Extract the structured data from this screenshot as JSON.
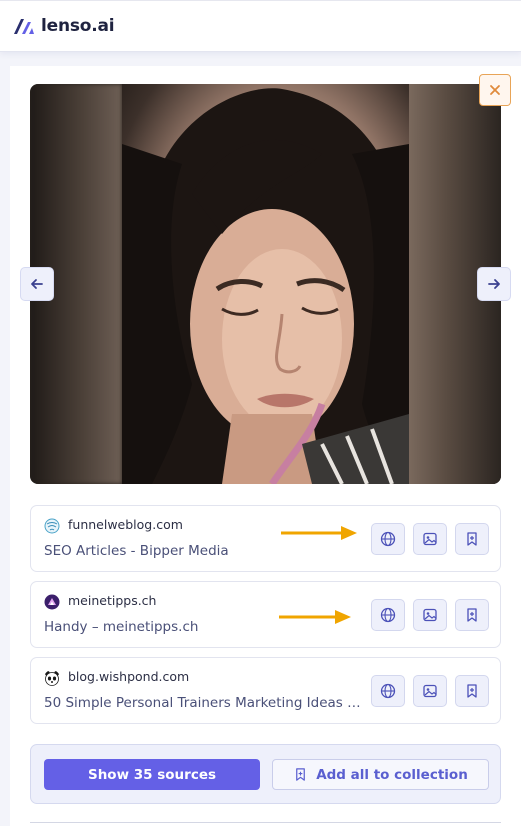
{
  "app": {
    "name": "lenso.ai"
  },
  "viewer": {
    "close_label": "×",
    "prev_label": "previous image",
    "next_label": "next image"
  },
  "results": [
    {
      "domain": "funnelweblog.com",
      "title": "SEO Articles - Bipper Media",
      "favicon": "funnelweblog-favicon-icon",
      "highlighted": true
    },
    {
      "domain": "meinetipps.ch",
      "title": "Handy – meinetipps.ch",
      "favicon": "meinetipps-favicon-icon",
      "highlighted": true
    },
    {
      "domain": "blog.wishpond.com",
      "title": "50 Simple Personal Trainers Marketing Ideas -...",
      "favicon": "wishpond-panda-favicon-icon",
      "highlighted": false
    }
  ],
  "result_actions": [
    "globe-icon",
    "image-icon",
    "bookmark-add-icon"
  ],
  "footer": {
    "show_sources_label": "Show 35 sources",
    "add_collection_label": "Add all to collection"
  },
  "colors": {
    "brand": "#6460e6",
    "annotation_arrow": "#f0a500",
    "close_border": "#e8a457"
  }
}
